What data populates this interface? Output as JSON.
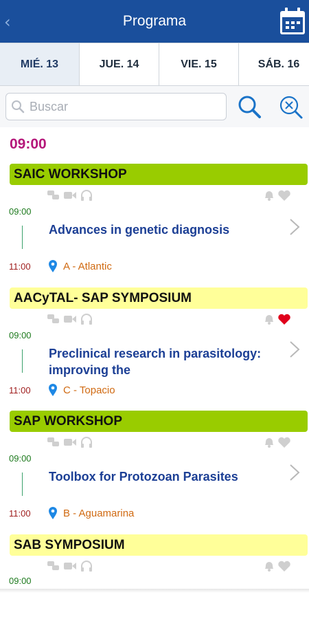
{
  "header": {
    "title": "Programa",
    "back_icon": "chevron-left-icon",
    "calendar_icon": "calendar-icon"
  },
  "tabs": [
    {
      "label": "MIÉ. 13"
    },
    {
      "label": "JUE. 14"
    },
    {
      "label": "VIE. 15"
    },
    {
      "label": "SÁB. 16"
    }
  ],
  "search": {
    "placeholder": "Buscar",
    "value": ""
  },
  "time_heading": "09:00",
  "colors": {
    "header": "#1a4f9c",
    "time_heading": "#b5177a",
    "green": "#99cc00",
    "yellow": "#ffff99",
    "talk_title": "#1c3f95",
    "room": "#d06a12",
    "start_time": "#1e7a1e",
    "end_time": "#9e1b1b"
  },
  "sessions": [
    {
      "title": "SAIC WORKSHOP",
      "color": "green",
      "start": "09:00",
      "end": "11:00",
      "talk": "Advances in genetic diagnosis",
      "room": "A - Atlantic",
      "favorite": false
    },
    {
      "title": "AACyTAL- SAP SYMPOSIUM",
      "color": "yellow",
      "start": "09:00",
      "end": "11:00",
      "talk": "Preclinical research in parasitology: improving the",
      "room": "C - Topacio",
      "favorite": true
    },
    {
      "title": "SAP WORKSHOP",
      "color": "green",
      "start": "09:00",
      "end": "11:00",
      "talk": "Toolbox for Protozoan Parasites",
      "room": "B - Aguamarina",
      "favorite": false
    },
    {
      "title": "SAB SYMPOSIUM",
      "color": "yellow",
      "start": "09:00",
      "favorite": false
    }
  ]
}
